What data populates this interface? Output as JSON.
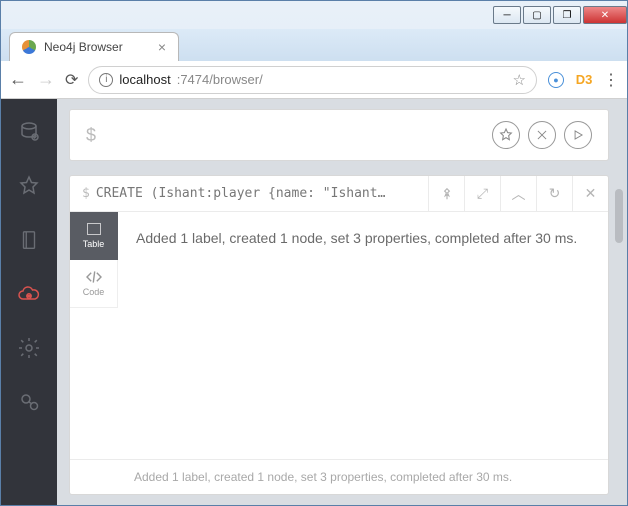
{
  "window": {
    "tab_title": "Neo4j Browser"
  },
  "addressbar": {
    "host": "localhost",
    "port_path": ":7474/browser/",
    "ext2_label": "D3"
  },
  "editor": {
    "prompt": "$",
    "value": ""
  },
  "result": {
    "prompt": "$",
    "query": "CREATE (Ishant:player {name: \"Ishant…",
    "view_tabs": {
      "table": "Table",
      "code": "Code"
    },
    "message": "Added 1 label, created 1 node, set 3 properties, completed after 30 ms.",
    "footer": "Added 1 label, created 1 node, set 3 properties, completed after 30 ms."
  }
}
